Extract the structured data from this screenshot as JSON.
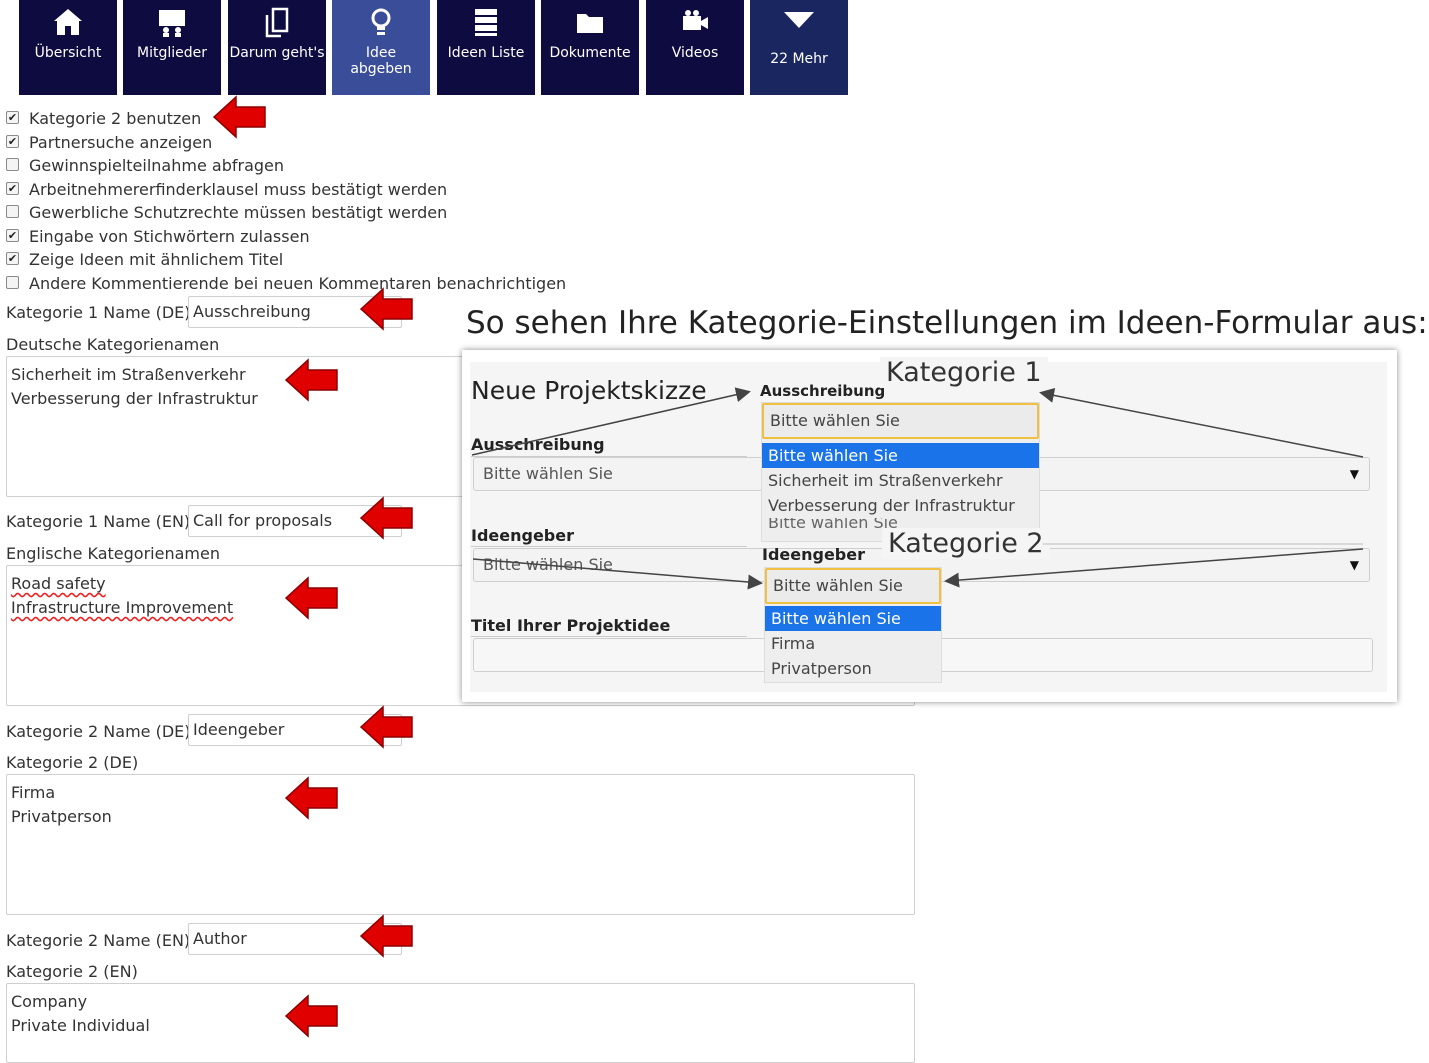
{
  "nav": {
    "items": [
      {
        "label": "Übersicht",
        "icon": "home-icon"
      },
      {
        "label": "Mitglieder",
        "icon": "members-icon"
      },
      {
        "label": "Darum geht's",
        "icon": "document-copy-icon"
      },
      {
        "label": "Idee abgeben",
        "icon": "lightbulb-icon"
      },
      {
        "label": "Ideen Liste",
        "icon": "list-icon"
      },
      {
        "label": "Dokumente",
        "icon": "folder-icon"
      },
      {
        "label": "Videos",
        "icon": "video-camera-icon"
      },
      {
        "label": "22 Mehr",
        "icon": "chevron-down-icon"
      }
    ],
    "colors": {
      "tile": "#0d0b3f",
      "active": "#3a4d99",
      "more": "#1a2660"
    }
  },
  "settings": {
    "checkboxes": [
      {
        "label": "Kategorie 2 benutzen",
        "checked": true
      },
      {
        "label": "Partnersuche anzeigen",
        "checked": true
      },
      {
        "label": "Gewinnspielteilnahme abfragen",
        "checked": false
      },
      {
        "label": "Arbeitnehmererfinderklausel muss bestätigt werden",
        "checked": true
      },
      {
        "label": "Gewerbliche Schutzrechte müssen bestätigt werden",
        "checked": false
      },
      {
        "label": "Eingabe von Stichwörtern zulassen",
        "checked": true
      },
      {
        "label": "Zeige Ideen mit ähnlichem Titel",
        "checked": true
      },
      {
        "label": "Andere Kommentierende bei neuen Kommentaren benachrichtigen",
        "checked": false
      }
    ],
    "k1_name_de": {
      "label": "Kategorie 1 Name (DE)",
      "value": "Ausschreibung"
    },
    "k1_names_de": {
      "label": "Deutsche Kategorienamen",
      "lines": [
        "Sicherheit im Straßenverkehr",
        "Verbesserung der Infrastruktur"
      ]
    },
    "k1_name_en": {
      "label": "Kategorie 1 Name (EN)",
      "value": "Call for proposals"
    },
    "k1_names_en": {
      "label": "Englische Kategorienamen",
      "lines": [
        "Road safety",
        "Infrastructure Improvement"
      ]
    },
    "k2_name_de": {
      "label": "Kategorie 2 Name (DE)",
      "value": "Ideengeber"
    },
    "k2_de": {
      "label": "Kategorie 2 (DE)",
      "lines": [
        "Firma",
        "Privatperson"
      ]
    },
    "k2_name_en": {
      "label": "Kategorie 2 Name (EN)",
      "value": "Author"
    },
    "k2_en": {
      "label": "Kategorie 2 (EN)",
      "lines": [
        "Company",
        "Private Individual"
      ]
    }
  },
  "arrow_color": "#e00000",
  "preview": {
    "caption": "So sehen Ihre Kategorie-Einstellungen im Ideen-Formular aus:",
    "title": "Neue Projektskizze",
    "field1_label": "Ausschreibung",
    "field1_value": "Bitte wählen Sie",
    "field2_label": "Ideengeber",
    "field2_value": "Bitte wählen Sie",
    "field3_label": "Titel Ihrer Projektidee",
    "dd1_label": "Ausschreibung",
    "dd1_head": "Bitte wählen Sie",
    "dd1_options": [
      "Bitte wählen Sie",
      "Sicherheit im Straßenverkehr",
      "Verbesserung der Infrastruktur"
    ],
    "dd1_behind": "Bitte wählen Sie",
    "dd2_label": "Ideengeber",
    "dd2_head": "Bitte wählen Sie",
    "dd2_options": [
      "Bitte wählen Sie",
      "Firma",
      "Privatperson"
    ],
    "kategorie1": "Kategorie 1",
    "kategorie2": "Kategorie 2",
    "caret": "▼",
    "highlight_color": "#1a73e8"
  }
}
